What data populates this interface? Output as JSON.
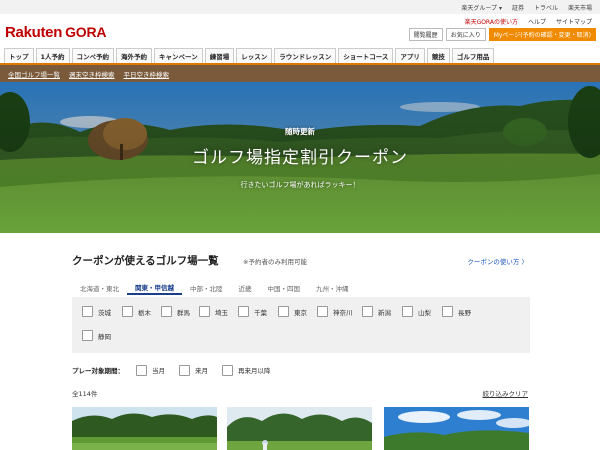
{
  "utility_bar": [
    "楽天グループ ▾",
    "証券",
    "トラベル",
    "楽天市場"
  ],
  "header": {
    "logo_rakuten": "Rakuten",
    "logo_gora": "GORA",
    "links": [
      "楽天GORAの使い方",
      "ヘルプ",
      "サイトマップ"
    ],
    "buttons": [
      "閲覧履歴",
      "お気に入り",
      "Myページ(予約の確認・変更・取消)"
    ]
  },
  "nav": [
    "トップ",
    "1人予約",
    "コンペ予約",
    "海外予約",
    "キャンペーン",
    "練習場",
    "レッスン",
    "ラウンドレッスン",
    "ショートコース",
    "アプリ",
    "競技",
    "ゴルフ用品"
  ],
  "subnav": [
    "全国ゴルフ場一覧",
    "週末空き枠検索",
    "平日空き枠検索"
  ],
  "hero": {
    "kicker": "随時更新",
    "title": "ゴルフ場指定割引クーポン",
    "subtitle": "行きたいゴルフ場があればラッキー！"
  },
  "section": {
    "title": "クーポンが使えるゴルフ場一覧",
    "note": "※予約者のみ利用可能",
    "howto_link": "クーポンの使い方 〉"
  },
  "regions": [
    "北海道・東北",
    "関東・甲信越",
    "中部・北陸",
    "近畿",
    "中国・四国",
    "九州・沖縄"
  ],
  "active_region": "関東・甲信越",
  "prefectures": [
    "茨城",
    "栃木",
    "群馬",
    "埼玉",
    "千葉",
    "東京",
    "神奈川",
    "新潟",
    "山梨",
    "長野",
    "静岡"
  ],
  "period": {
    "label": "プレー対象期間：",
    "options": [
      "当月",
      "来月",
      "再来月以降"
    ]
  },
  "result_count": "全114件",
  "clear_label": "絞り込みクリア",
  "colors": {
    "brand": "#bf0000",
    "nav_accent": "#e07800",
    "subnav_bg": "#7a5a3a",
    "link": "#1a56c4",
    "active_region": "#1a3d8c"
  }
}
